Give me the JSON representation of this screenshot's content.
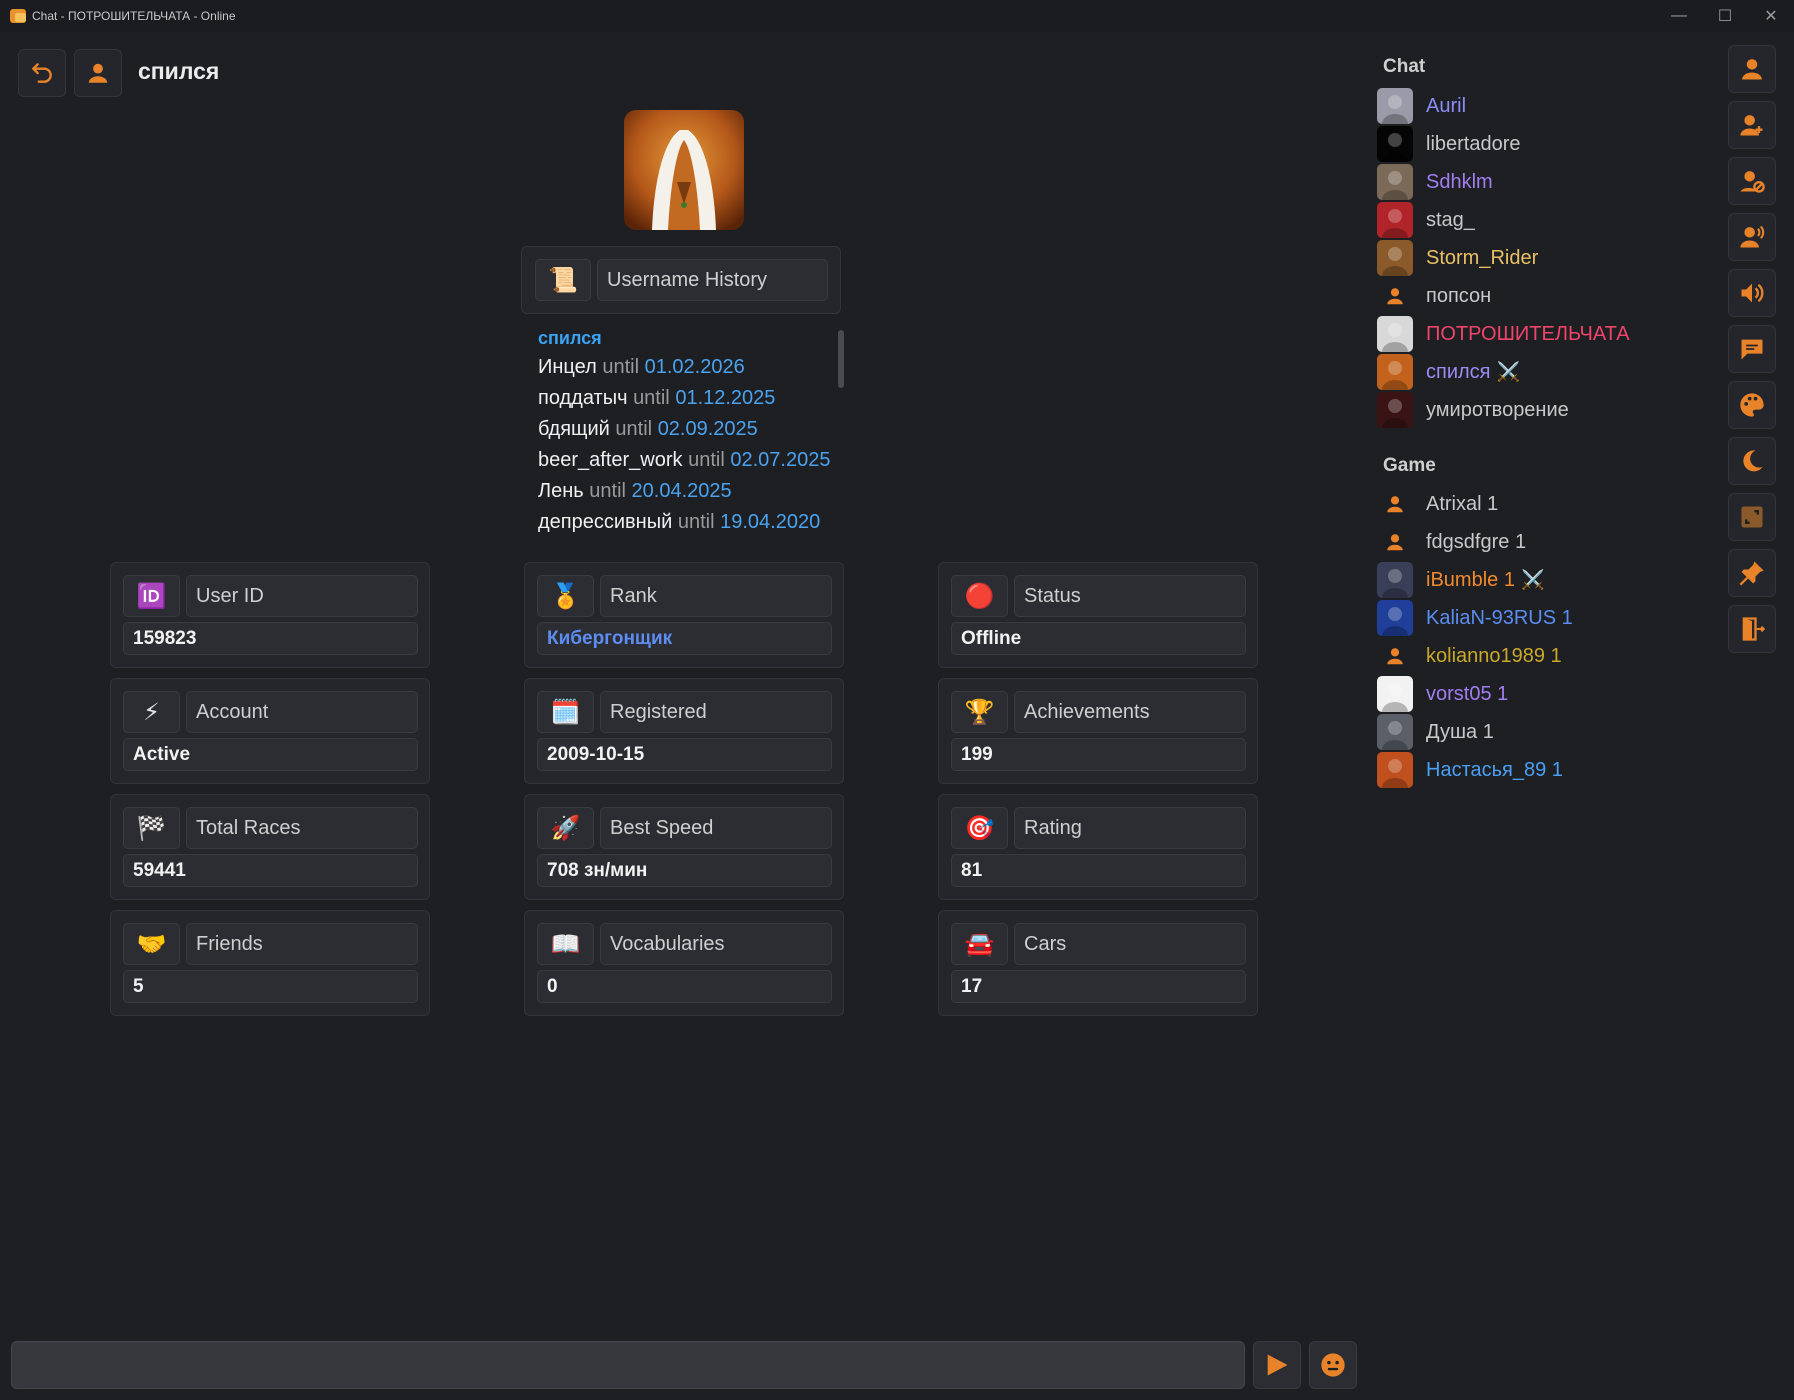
{
  "window": {
    "title": "Chat - ПОТРОШИТЕЛЬЧАТА - Online",
    "minimize": "—",
    "maximize": "☐",
    "close": "✕"
  },
  "profile": {
    "username": "спился",
    "username_history_label": "Username History",
    "current_name": "спился",
    "until_word": "until",
    "history": [
      {
        "name": "Инцел",
        "date": "01.02.2026"
      },
      {
        "name": "поддатыч",
        "date": "01.12.2025"
      },
      {
        "name": "бдящий",
        "date": "02.09.2025"
      },
      {
        "name": "beer_after_work",
        "date": "02.07.2025"
      },
      {
        "name": "Лень",
        "date": "20.04.2025"
      },
      {
        "name": "депрессивный",
        "date": "19.04.2020"
      }
    ]
  },
  "stats": [
    {
      "icon": "🆔",
      "icon_name": "id-icon",
      "label": "User ID",
      "value": "159823"
    },
    {
      "icon": "🏅",
      "icon_name": "medal-icon",
      "label": "Rank",
      "value": "Кибергонщик"
    },
    {
      "icon": "🔴",
      "icon_name": "red-circle-icon",
      "label": "Status",
      "value": "Offline"
    },
    {
      "icon": "⚡",
      "icon_name": "lightning-icon",
      "label": "Account",
      "value": "Active"
    },
    {
      "icon": "🗓️",
      "icon_name": "calendar-icon",
      "label": "Registered",
      "value": "2009-10-15"
    },
    {
      "icon": "🏆",
      "icon_name": "trophy-icon",
      "label": "Achievements",
      "value": "199"
    },
    {
      "icon": "🏁",
      "icon_name": "checkered-flag-icon",
      "label": "Total Races",
      "value": "59441"
    },
    {
      "icon": "🚀",
      "icon_name": "rocket-icon",
      "label": "Best Speed",
      "value": "708 зн/мин"
    },
    {
      "icon": "🎯",
      "icon_name": "target-icon",
      "label": "Rating",
      "value": "81"
    },
    {
      "icon": "🤝",
      "icon_name": "handshake-icon",
      "label": "Friends",
      "value": "5"
    },
    {
      "icon": "📖",
      "icon_name": "book-icon",
      "label": "Vocabularies",
      "value": "0"
    },
    {
      "icon": "🚘",
      "icon_name": "car-icon",
      "label": "Cars",
      "value": "17"
    }
  ],
  "chat_section": {
    "title": "Chat",
    "users": [
      {
        "name": "Auril",
        "color": "#8b8cf8",
        "avatar": "photo",
        "avatar_bg": "#9a9aa8"
      },
      {
        "name": "libertadore",
        "color": "#c8c8c8",
        "avatar": "photo",
        "avatar_bg": "#050505"
      },
      {
        "name": "Sdhklm",
        "color": "#a07ef0",
        "avatar": "photo",
        "avatar_bg": "#7c6a58"
      },
      {
        "name": "stag_",
        "color": "#c8c8c8",
        "avatar": "photo",
        "avatar_bg": "#b0242a"
      },
      {
        "name": "Storm_Rider",
        "color": "#e8c064",
        "avatar": "photo",
        "avatar_bg": "#8a5a2a"
      },
      {
        "name": "попсон",
        "color": "#c8c8c8",
        "avatar": "person"
      },
      {
        "name": "ПОТРОШИТЕЛЬЧАТА",
        "color": "#f0446a",
        "avatar": "photo",
        "avatar_bg": "#d8d8d8"
      },
      {
        "name": "спился",
        "color": "#9d8cf4",
        "badge": "⚔️",
        "avatar": "photo",
        "avatar_bg": "#c2621c"
      },
      {
        "name": "умиротворение",
        "color": "#c8c8c8",
        "avatar": "photo",
        "avatar_bg": "#3a1414"
      }
    ]
  },
  "game_section": {
    "title": "Game",
    "users": [
      {
        "name": "Atrixal 1",
        "color": "#c8c8c8",
        "avatar": "person"
      },
      {
        "name": "fdgsdfgre 1",
        "color": "#c8c8c8",
        "avatar": "person"
      },
      {
        "name": "iBumble 1",
        "color": "#f28a2c",
        "badge": "⚔️",
        "avatar": "photo",
        "avatar_bg": "#3a3f58"
      },
      {
        "name": "KaliaN-93RUS 1",
        "color": "#5b8ef2",
        "avatar": "photo",
        "avatar_bg": "#1f3f9a"
      },
      {
        "name": "kolianno1989 1",
        "color": "#c9a82a",
        "avatar": "person"
      },
      {
        "name": "vorst05 1",
        "color": "#a07ef0",
        "avatar": "photo",
        "avatar_bg": "#f2f2f2"
      },
      {
        "name": "Душа 1",
        "color": "#c8c8c8",
        "avatar": "photo",
        "avatar_bg": "#5a5f68"
      },
      {
        "name": "Настасья_89 1",
        "color": "#4aa0f4",
        "avatar": "photo",
        "avatar_bg": "#c0501e"
      }
    ]
  },
  "sidebar_buttons": [
    {
      "name": "profile-icon"
    },
    {
      "name": "user-add-icon"
    },
    {
      "name": "user-block-icon"
    },
    {
      "name": "user-voice-icon"
    },
    {
      "name": "volume-icon"
    },
    {
      "name": "chat-bubble-icon"
    },
    {
      "name": "palette-icon"
    },
    {
      "name": "moon-icon"
    },
    {
      "name": "expand-icon"
    },
    {
      "name": "pin-icon"
    },
    {
      "name": "exit-icon"
    }
  ],
  "composer": {
    "placeholder": ""
  },
  "colors": {
    "accent": "#e8832a",
    "background": "#1e1f23",
    "panel": "#25262b",
    "link_blue": "#4aa3f0"
  }
}
